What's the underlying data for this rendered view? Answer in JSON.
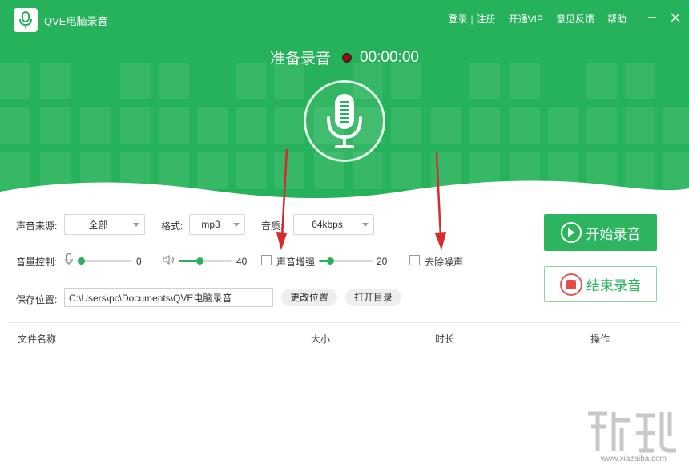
{
  "app": {
    "title": "QVE电脑录音"
  },
  "topnav": {
    "login": "登录",
    "sep": "|",
    "register": "注册",
    "vip": "开通VIP",
    "feedback": "意见反馈",
    "help": "帮助"
  },
  "window": {
    "minimize_icon": "minimize-icon",
    "close_icon": "close-icon"
  },
  "status": {
    "label": "准备录音",
    "time": "00:00:00",
    "dot_color": "#b40000"
  },
  "controls": {
    "source_label": "声音来源:",
    "source_value": "全部",
    "format_label": "格式:",
    "format_value": "mp3",
    "quality_label": "音质:",
    "quality_value": "64kbps",
    "volume_label": "音量控制:",
    "mic_value": "0",
    "mic_level": 0,
    "speaker_value": "40",
    "speaker_level": 40,
    "enhance_label": "声音增强",
    "enhance_checked": false,
    "enhance_value": "20",
    "enhance_level": 20,
    "denoise_label": "去除噪声",
    "denoise_checked": false,
    "save_label": "保存位置:",
    "save_path": "C:\\Users\\pc\\Documents\\QVE电脑录音",
    "change_button": "更改位置",
    "open_button": "打开目录"
  },
  "actions": {
    "start": "开始录音",
    "stop": "结束录音"
  },
  "table": {
    "columns": [
      "文件名称",
      "大小",
      "时长",
      "操作"
    ],
    "rows": []
  },
  "watermark": {
    "site": "www.xiazaiba.com"
  },
  "colors": {
    "brand": "#26b25a",
    "button": "#2db45e",
    "stop": "#e84b4b",
    "arrow": "#d62b2b"
  }
}
